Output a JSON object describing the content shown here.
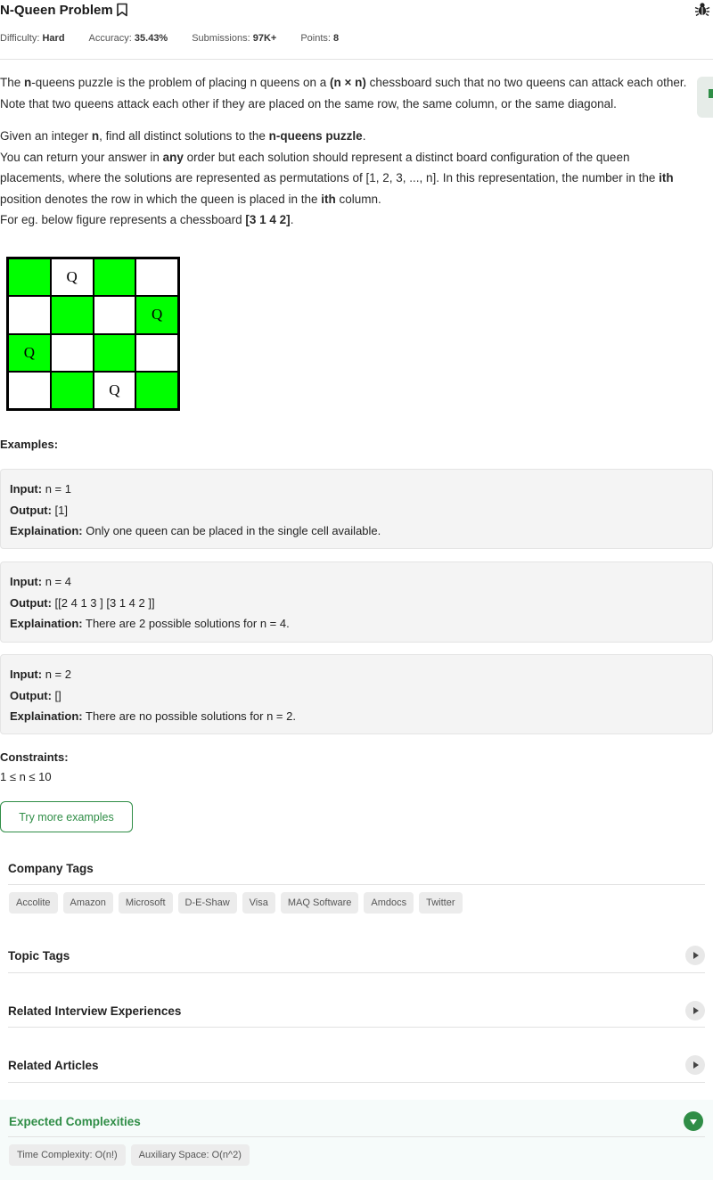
{
  "problem": {
    "title": "N-Queen Problem",
    "difficulty_label": "Difficulty:",
    "difficulty": "Hard",
    "accuracy_label": "Accuracy:",
    "accuracy": "35.43%",
    "submissions_label": "Submissions:",
    "submissions": "97K+",
    "points_label": "Points:",
    "points": "8"
  },
  "description": {
    "p1_a": "The ",
    "p1_b": "n",
    "p1_c": "-queens puzzle is the problem of placing n queens on a ",
    "p1_d": "(n × n)",
    "p1_e": " chessboard such that no two queens can attack each other.",
    "p2": "Note that two queens attack each other if they are placed on the same row, the same column, or the same diagonal.",
    "p3_a": "Given an integer ",
    "p3_b": "n",
    "p3_c": ", find all distinct solutions to the ",
    "p3_d": "n-queens puzzle",
    "p3_e": ".",
    "p4_a": "You can return your answer in ",
    "p4_b": "any",
    "p4_c": " order but each solution should represent a distinct board configuration of the queen",
    "p5_a": "placements, where the solutions are represented as permutations of [1, 2, 3, ..., n]. In this representation, the number in the ",
    "p5_b": "ith",
    "p6_a": "position denotes the row in which the queen is placed in the ",
    "p6_b": "ith",
    "p6_c": " column.",
    "p7_a": "For eg. below figure represents a chessboard ",
    "p7_b": "[3 1 4 2]",
    "p7_c": "."
  },
  "board": {
    "queen_symbol": "Q",
    "green": "#00ff00",
    "rows": [
      [
        "g",
        "wQ",
        "g",
        "w"
      ],
      [
        "w",
        "g",
        "w",
        "gQ"
      ],
      [
        "gQ",
        "w",
        "g",
        "w"
      ],
      [
        "w",
        "g",
        "wQ",
        "g"
      ]
    ]
  },
  "examples_label": "Examples:",
  "examples": [
    {
      "input_label": "Input:",
      "input": "n = 1",
      "output_label": "Output:",
      "output": "[1]",
      "expl_label": "Explaination:",
      "expl": "Only one queen can be placed in the single cell available."
    },
    {
      "input_label": "Input:",
      "input": "n = 4",
      "output_label": "Output:",
      "output": "[[2 4 1 3 ] [3 1 4 2 ]]",
      "expl_label": "Explaination:",
      "expl": "There are 2 possible solutions for n = 4."
    },
    {
      "input_label": "Input:",
      "input": "n = 2",
      "output_label": "Output:",
      "output": "[]",
      "expl_label": "Explaination:",
      "expl": "There are no possible solutions for n = 2."
    }
  ],
  "constraints_label": "Constraints:",
  "constraints": "1 ≤ n ≤ 10",
  "try_more": "Try more examples",
  "company_tags_label": "Company Tags",
  "company_tags": [
    "Accolite",
    "Amazon",
    "Microsoft",
    "D-E-Shaw",
    "Visa",
    "MAQ Software",
    "Amdocs",
    "Twitter"
  ],
  "topic_tags_label": "Topic Tags",
  "related_interview_label": "Related Interview Experiences",
  "related_articles_label": "Related Articles",
  "expected_label": "Expected Complexities",
  "complexities": [
    "Time Complexity: O(n!)",
    "Auxiliary Space: O(n^2)"
  ],
  "colors": {
    "accent": "#2f8d46"
  },
  "icons": [
    "bookmark-icon",
    "bug-icon",
    "chevron-right-icon",
    "chevron-down-icon"
  ]
}
